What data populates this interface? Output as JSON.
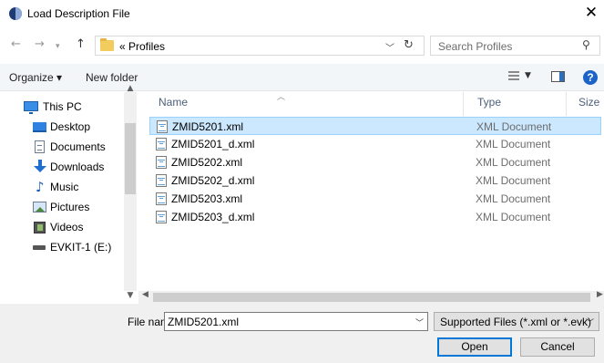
{
  "window": {
    "title": "Load Description File",
    "close_glyph": "✕"
  },
  "address": {
    "breadcrumb": "« Profiles",
    "search_placeholder": "Search Profiles"
  },
  "toolbar": {
    "organize_label": "Organize ▾",
    "new_folder_label": "New folder",
    "help_glyph": "?"
  },
  "nav_items": [
    {
      "label": "This PC",
      "icon": "this-pc-icon"
    },
    {
      "label": "Desktop",
      "icon": "desktop-icon"
    },
    {
      "label": "Documents",
      "icon": "documents-icon"
    },
    {
      "label": "Downloads",
      "icon": "downloads-icon"
    },
    {
      "label": "Music",
      "icon": "music-icon"
    },
    {
      "label": "Pictures",
      "icon": "pictures-icon"
    },
    {
      "label": "Videos",
      "icon": "videos-icon"
    },
    {
      "label": "EVKIT-1 (E:)",
      "icon": "drive-icon"
    }
  ],
  "columns": {
    "name": "Name",
    "type": "Type",
    "size": "Size"
  },
  "files": [
    {
      "name": "ZMID5201.xml",
      "type": "XML Document",
      "selected": true
    },
    {
      "name": "ZMID5201_d.xml",
      "type": "XML Document",
      "selected": false
    },
    {
      "name": "ZMID5202.xml",
      "type": "XML Document",
      "selected": false
    },
    {
      "name": "ZMID5202_d.xml",
      "type": "XML Document",
      "selected": false
    },
    {
      "name": "ZMID5203.xml",
      "type": "XML Document",
      "selected": false
    },
    {
      "name": "ZMID5203_d.xml",
      "type": "XML Document",
      "selected": false
    }
  ],
  "bottom": {
    "file_name_label": "File name:",
    "file_name_value": "ZMID5201.xml",
    "file_type_filter": "Supported Files (*.xml or *.evk)",
    "open_label": "Open",
    "cancel_label": "Cancel"
  },
  "colors": {
    "selection": "#cce8ff",
    "selection_border": "#99d1ff",
    "accent": "#0078d7"
  }
}
